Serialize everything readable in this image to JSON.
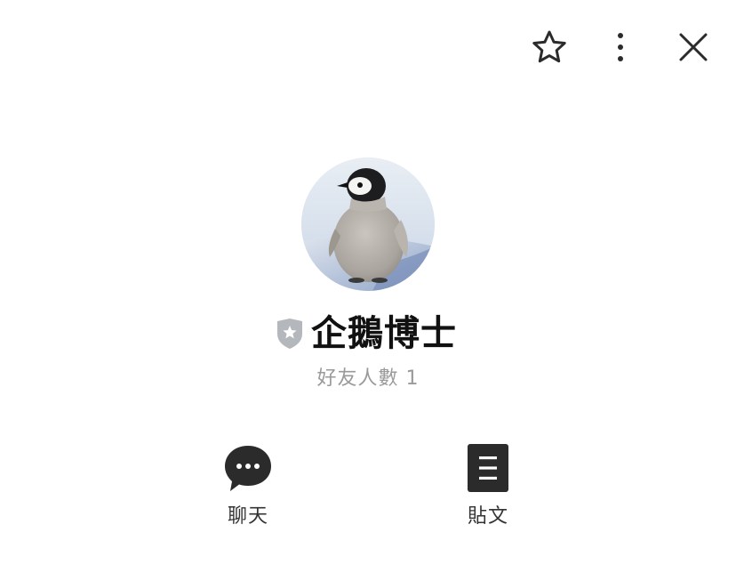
{
  "header": {
    "favorite_icon": "star-outline-icon",
    "more_icon": "vertical-dots-icon",
    "close_icon": "close-x-icon"
  },
  "profile": {
    "avatar": "penguin-chick-photo",
    "badge_icon": "verified-shield-star-icon",
    "badge_color": "#b4b7bc",
    "name": "企鵝博士",
    "friend_count": "好友人數 1"
  },
  "actions": [
    {
      "icon": "chat-bubble-icon",
      "label": "聊天"
    },
    {
      "icon": "document-icon",
      "label": "貼文"
    }
  ],
  "colors": {
    "icon_dark": "#2b2b2b",
    "text_primary": "#111111",
    "text_secondary": "#9a9a9a"
  }
}
